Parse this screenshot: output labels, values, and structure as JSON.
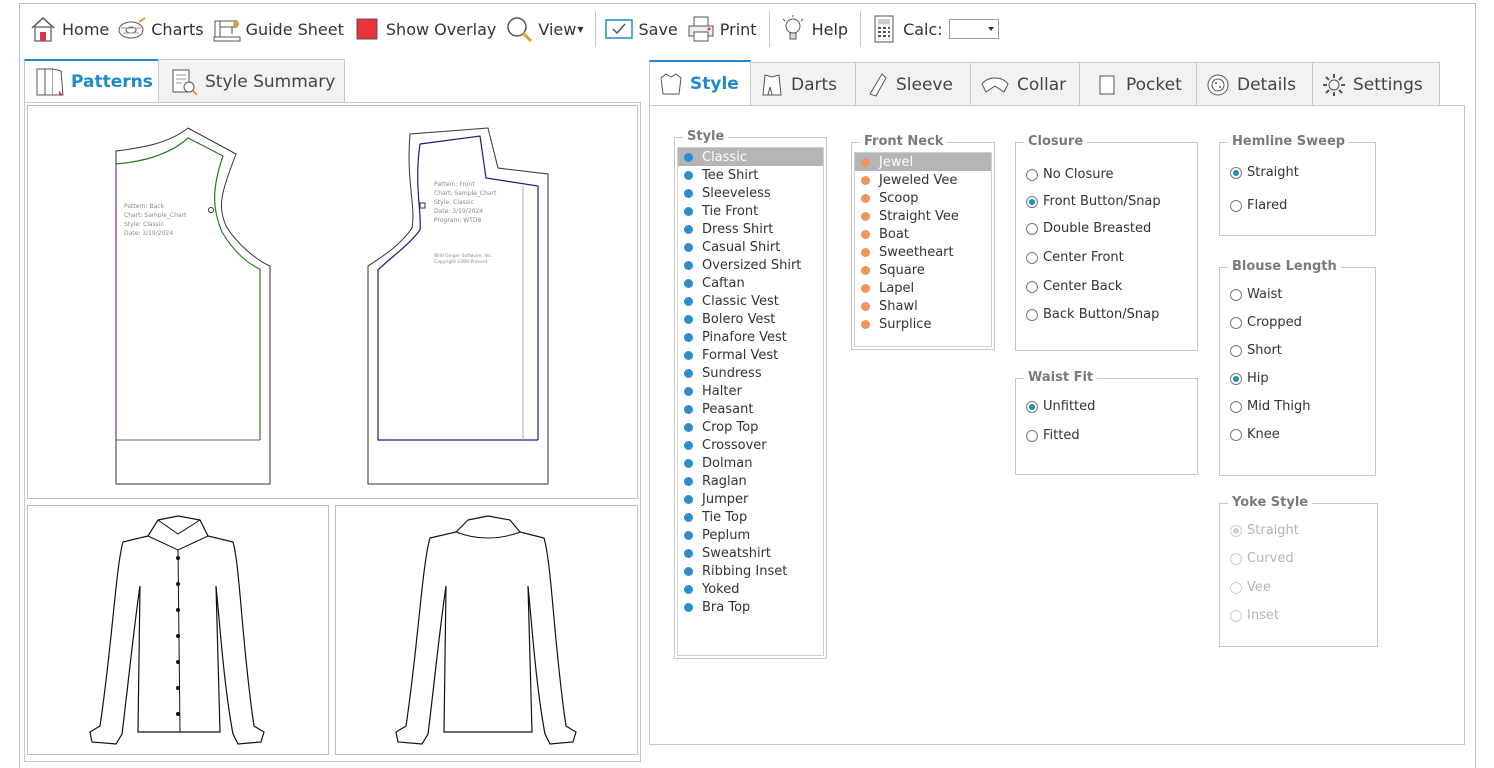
{
  "toolbar": {
    "home": "Home",
    "charts": "Charts",
    "guide_sheet": "Guide Sheet",
    "show_overlay": "Show Overlay",
    "view": "View",
    "save": "Save",
    "print": "Print",
    "help": "Help",
    "calc": "Calc:",
    "calc_value": ""
  },
  "left_tabs": {
    "patterns": "Patterns",
    "style_summary": "Style Summary"
  },
  "pattern_back": {
    "line1": "Pattern: Back",
    "line2": "Chart: Sample_Chart",
    "line3": "Style: Classic",
    "line4": "Date: 3/19/2024"
  },
  "pattern_front": {
    "line1": "Pattern: Front",
    "line2": "Chart: Sample_Chart",
    "line3": "Style: Classic",
    "line4": "Date: 3/19/2024",
    "line5": "Program: WTD8",
    "copyright1": "Wild Ginger Software, Inc.",
    "copyright2": "Copyright 1999-Present"
  },
  "right_tabs": {
    "style": "Style",
    "darts": "Darts",
    "sleeve": "Sleeve",
    "collar": "Collar",
    "pocket": "Pocket",
    "details": "Details",
    "settings": "Settings"
  },
  "style_group": {
    "title": "Style",
    "items": [
      "Classic",
      "Tee Shirt",
      "Sleeveless",
      "Tie Front",
      "Dress Shirt",
      "Casual Shirt",
      "Oversized Shirt",
      "Caftan",
      "Classic Vest",
      "Bolero Vest",
      "Pinafore Vest",
      "Formal Vest",
      "Sundress",
      "Halter",
      "Peasant",
      "Crop Top",
      "Crossover",
      "Dolman",
      "Raglan",
      "Jumper",
      "Tie Top",
      "Peplum",
      "Sweatshirt",
      "Ribbing Inset",
      "Yoked",
      "Bra Top"
    ],
    "selected": "Classic"
  },
  "front_neck_group": {
    "title": "Front Neck",
    "items": [
      "Jewel",
      "Jeweled Vee",
      "Scoop",
      "Straight Vee",
      "Boat",
      "Sweetheart",
      "Square",
      "Lapel",
      "Shawl",
      "Surplice"
    ],
    "selected": "Jewel"
  },
  "closure_group": {
    "title": "Closure",
    "options": [
      "No Closure",
      "Front Button/Snap",
      "Double Breasted",
      "Center Front",
      "Center Back",
      "Back Button/Snap"
    ],
    "selected": "Front Button/Snap"
  },
  "waist_fit_group": {
    "title": "Waist Fit",
    "options": [
      "Unfitted",
      "Fitted"
    ],
    "selected": "Unfitted"
  },
  "hemline_group": {
    "title": "Hemline Sweep",
    "options": [
      "Straight",
      "Flared"
    ],
    "selected": "Straight"
  },
  "blouse_length_group": {
    "title": "Blouse Length",
    "options": [
      "Waist",
      "Cropped",
      "Short",
      "Hip",
      "Mid Thigh",
      "Knee"
    ],
    "selected": "Hip"
  },
  "yoke_group": {
    "title": "Yoke Style",
    "options": [
      "Straight",
      "Curved",
      "Vee",
      "Inset"
    ],
    "selected": "Straight",
    "disabled": true
  },
  "colors": {
    "accent": "#1f8bc8",
    "style_dot": "#2a8ed0",
    "neck_dot": "#f0955a",
    "selected_row": "#b5b5b5"
  }
}
